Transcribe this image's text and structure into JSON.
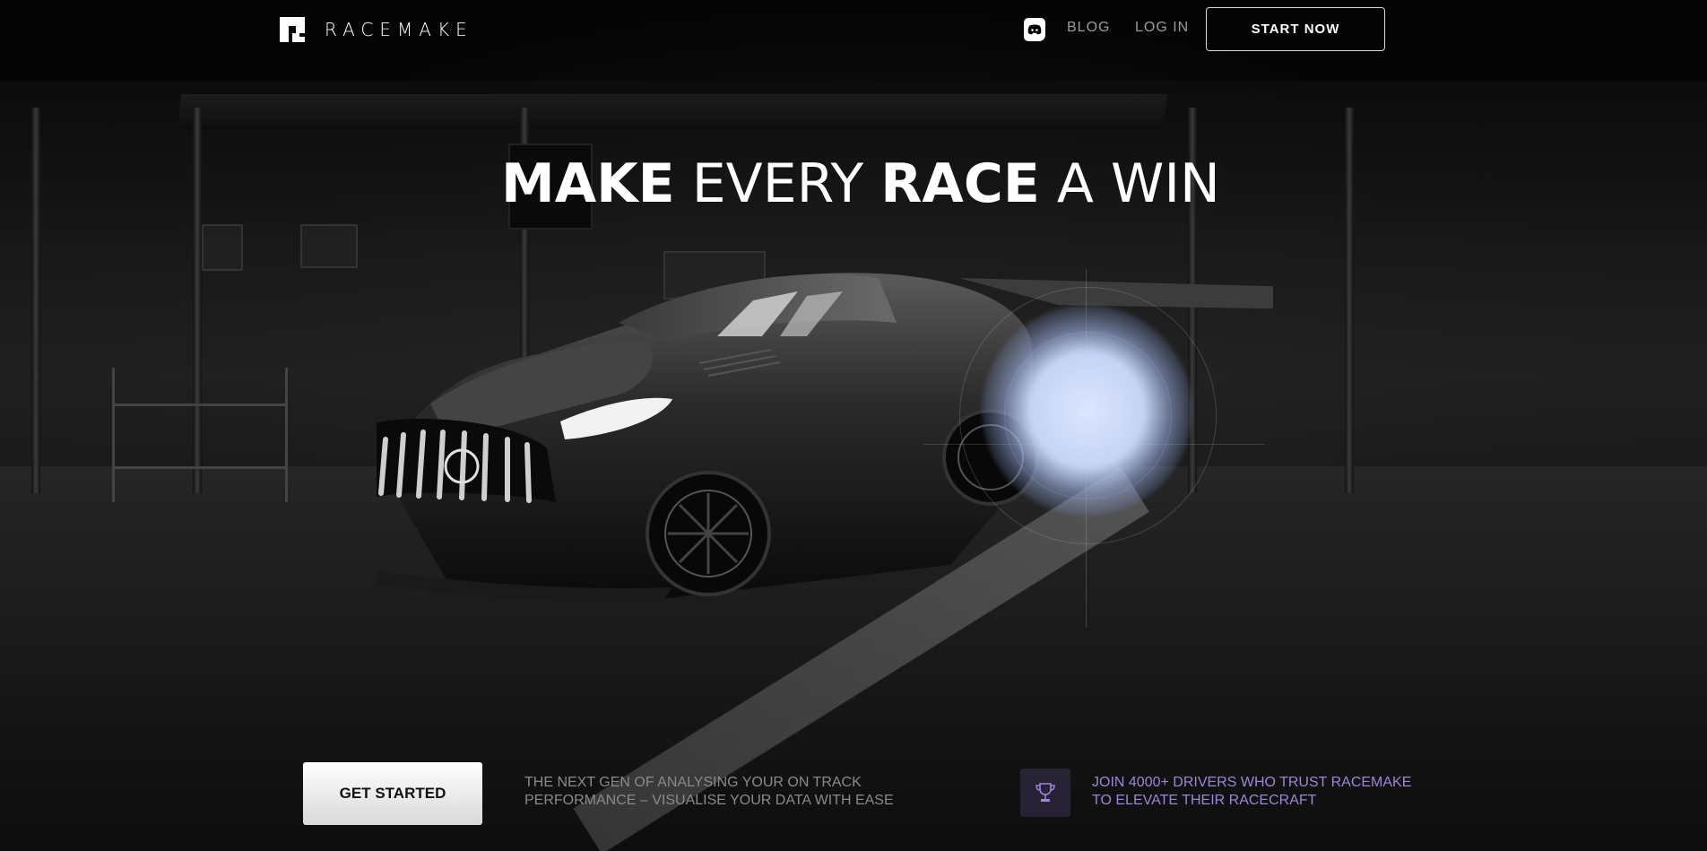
{
  "nav": {
    "brand": "RACEMAKE",
    "discord_icon": "discord-icon",
    "blog": "BLOG",
    "login": "LOG IN",
    "start_now": "START NOW"
  },
  "hero": {
    "headline_parts": [
      "MAKE",
      "EVERY",
      "RACE",
      "A WIN"
    ],
    "background": "dark garage with black sports car"
  },
  "bottom": {
    "get_started": "GET STARTED",
    "tagline": "THE NEXT GEN OF ANALYSING YOUR ON TRACK PERFORMANCE – VISUALISE YOUR DATA WITH EASE",
    "trophy_icon": "trophy-icon",
    "trust_text": "JOIN 4000+ DRIVERS WHO TRUST RACEMAKE TO ELEVATE THEIR RACECRAFT"
  },
  "colors": {
    "accent_purple": "#9d86d6",
    "glow": "#c5d4f5",
    "background": "#050505"
  }
}
